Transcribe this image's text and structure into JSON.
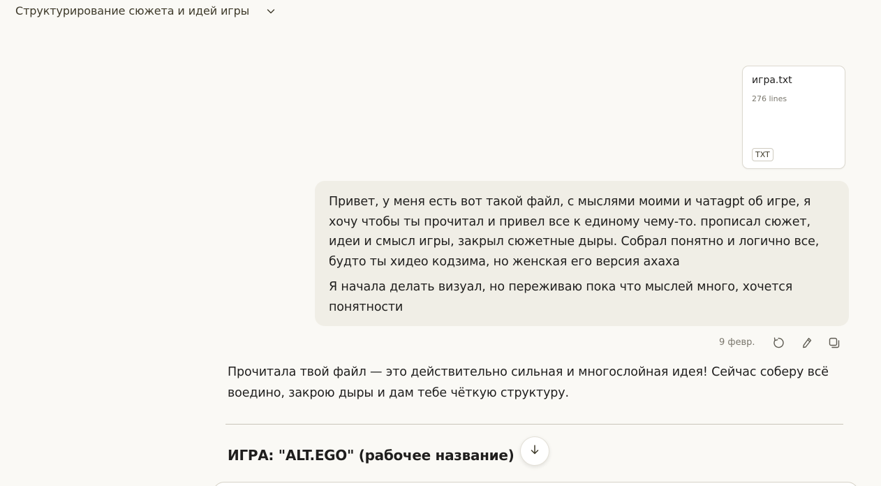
{
  "header": {
    "title": "Структурирование сюжета и идей игры",
    "chevron_icon": "chevron-down-icon"
  },
  "attachment": {
    "name": "игра.txt",
    "lines": "276 lines",
    "type_badge": "TXT"
  },
  "user_message": {
    "paragraph1": "Привет, у меня есть вот такой файл, с мыслями моими и чатаgpt об игре, я хочу чтобы ты прочитал и привел все к единому чему-то. прописал сюжет, идеи и смысл игры, закрыл сюжетные дыры. Собрал понятно и логично все, будто ты хидео кодзима, но женская его версия ахаха",
    "paragraph2": "Я начала делать визуал, но переживаю пока что мыслей много, хочется понятности",
    "date": "9 февр.",
    "actions": [
      "retry-icon",
      "edit-icon",
      "copy-icon"
    ]
  },
  "assistant_message": {
    "text": "Прочитала твой файл — это действительно сильная и многослойная идея! Сейчас соберу всё воедино, закрою дыры и дам тебе чёткую структуру.",
    "heading": "ИГРА: \"ALT.EGO\" (рабочее название)"
  },
  "scroll_button_icon": "arrow-down-icon",
  "colors": {
    "background": "#faf9f5",
    "user_bubble": "#f0eee6",
    "text": "#1f1e1d",
    "muted": "#7a776d"
  }
}
